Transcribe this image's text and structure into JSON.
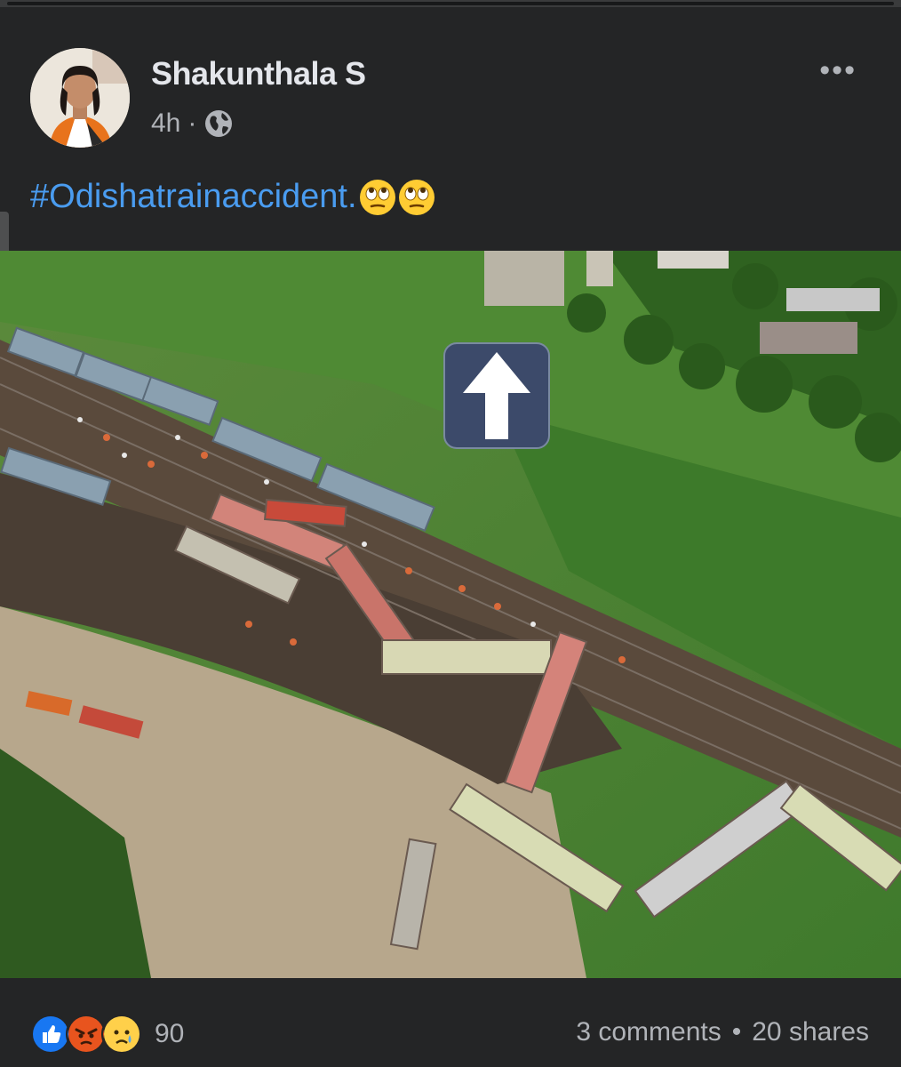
{
  "post": {
    "author": "Shakunthala S",
    "time": "4h",
    "separator": "·",
    "hashtag": "#Odishatrainaccident.",
    "more_label": "•••"
  },
  "footer": {
    "reaction_count": "90",
    "comments": "3 comments",
    "separator": "•",
    "shares": "20 shares"
  },
  "icons": {
    "audience": "globe-icon",
    "more": "more-options-icon",
    "emoji": "face-with-rolling-eyes-emoji",
    "reactions": [
      "like-reaction-icon",
      "angry-reaction-icon",
      "sad-reaction-icon"
    ]
  },
  "colors": {
    "background": "#242526",
    "hashtag": "#4a9cf0",
    "secondary_text": "#b0b3b8",
    "like_blue": "#1877f2"
  }
}
